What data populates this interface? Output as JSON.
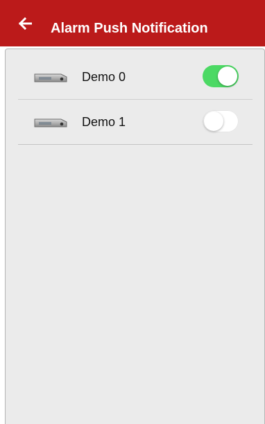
{
  "header": {
    "title": "Alarm Push Notification",
    "back_icon": "arrow-left-icon",
    "background_color": "#bb1a1a"
  },
  "devices": [
    {
      "name": "Demo 0",
      "icon": "dvr-device-icon",
      "push_enabled": true
    },
    {
      "name": "Demo 1",
      "icon": "dvr-device-icon",
      "push_enabled": false
    }
  ],
  "colors": {
    "switch_on": "#4cd964",
    "switch_off": "#ffffff",
    "content_background": "#ebebeb"
  }
}
